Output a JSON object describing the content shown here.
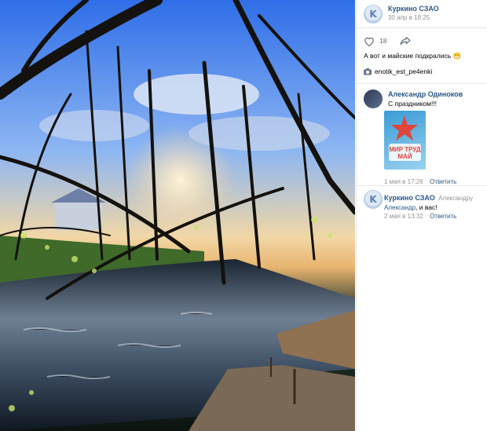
{
  "post": {
    "author": "Куркино СЗАО",
    "date": "30 апр в 18:25",
    "likes": "18",
    "caption": "А вот и майские подкрались 😁",
    "tag": "enotik_est_pe4enki"
  },
  "comments": [
    {
      "author": "Александр Одиноков",
      "text": "С праздником!!!",
      "card_text": "МИР ТРУД МАЙ",
      "date": "1 мая в 17:26",
      "reply_label": "Ответить"
    },
    {
      "author": "Куркино СЗАО",
      "reply_to": "Александру",
      "mention": "Александр",
      "text": ", и вас!",
      "date": "2 мая в 13:32",
      "reply_label": "Ответить"
    }
  ],
  "colors": {
    "link": "#2a5885",
    "meta": "#939393",
    "accent_star": "#e0443a"
  },
  "icons": [
    "heart-icon",
    "share-icon",
    "camera-icon",
    "k-logo"
  ]
}
